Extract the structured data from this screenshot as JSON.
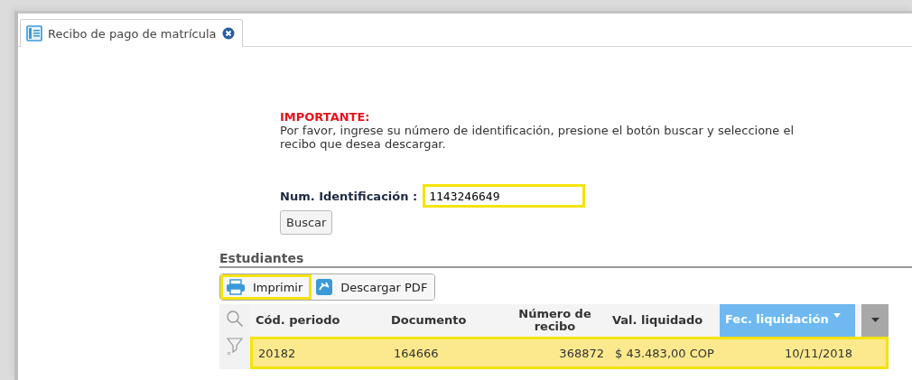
{
  "tab": {
    "label": "Recibo de pago de matrícula",
    "selected": true
  },
  "notice": {
    "title": "IMPORTANTE:",
    "text": "Por favor, ingrese su número de identificación, presione el botón buscar y seleccione el recibo que desea descargar."
  },
  "id_field": {
    "label": "Num. Identificación :",
    "value": "1143246649",
    "highlighted": true
  },
  "search_button": "Buscar",
  "section_title": "Estudiantes",
  "toolbar": [
    {
      "kind": "print",
      "label": "Imprimir",
      "highlighted": true
    },
    {
      "kind": "pdf",
      "label": "Descargar PDF",
      "highlighted": false
    }
  ],
  "table": {
    "columns": [
      {
        "label": "Cód. periodo",
        "sorted": false
      },
      {
        "label": "Documento",
        "sorted": false
      },
      {
        "label": "Número de recibo",
        "sorted": false
      },
      {
        "label": "Val. liquidado",
        "sorted": false
      },
      {
        "label": "Fec. liquidación",
        "sorted": true
      }
    ],
    "rows": [
      {
        "cells": [
          "20182",
          "164666",
          "368872",
          "$ 43.483,00 COP",
          "10/11/2018"
        ],
        "selected": true,
        "highlighted": true
      }
    ]
  }
}
